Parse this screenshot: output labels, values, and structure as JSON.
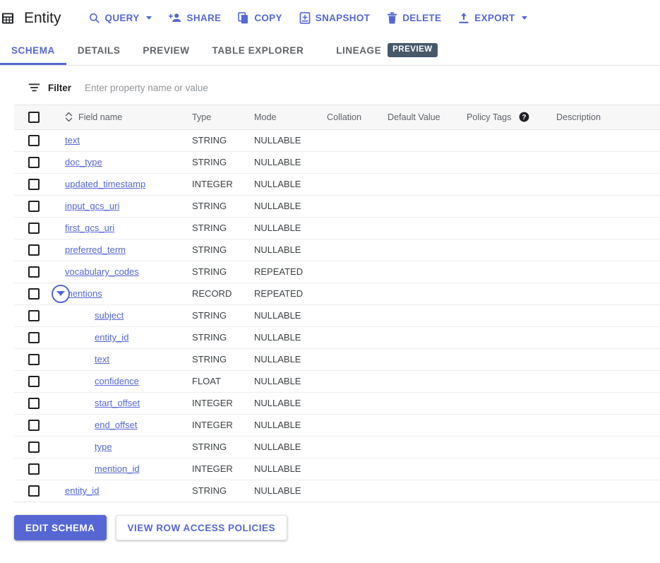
{
  "header": {
    "icon": "table-grid-icon",
    "title": "Entity",
    "actions": [
      {
        "id": "query",
        "label": "QUERY",
        "icon": "search-icon",
        "has_caret": true
      },
      {
        "id": "share",
        "label": "SHARE",
        "icon": "person-add-icon",
        "has_caret": false
      },
      {
        "id": "copy",
        "label": "COPY",
        "icon": "copy-icon",
        "has_caret": false
      },
      {
        "id": "snapshot",
        "label": "SNAPSHOT",
        "icon": "snapshot-icon",
        "has_caret": false
      },
      {
        "id": "delete",
        "label": "DELETE",
        "icon": "trash-icon",
        "has_caret": false
      },
      {
        "id": "export",
        "label": "EXPORT",
        "icon": "upload-icon",
        "has_caret": true
      }
    ]
  },
  "tabs": {
    "items": [
      {
        "id": "schema",
        "label": "SCHEMA",
        "active": true
      },
      {
        "id": "details",
        "label": "DETAILS",
        "active": false
      },
      {
        "id": "preview",
        "label": "PREVIEW",
        "active": false
      },
      {
        "id": "table-explorer",
        "label": "TABLE EXPLORER",
        "active": false
      },
      {
        "id": "lineage",
        "label": "LINEAGE",
        "active": false
      }
    ],
    "lineage_badge": "PREVIEW"
  },
  "filter": {
    "icon": "filter-icon",
    "label": "Filter",
    "placeholder": "Enter property name or value",
    "value": ""
  },
  "table": {
    "columns": [
      {
        "id": "checkbox",
        "label": ""
      },
      {
        "id": "field_name",
        "label": "Field name"
      },
      {
        "id": "type",
        "label": "Type"
      },
      {
        "id": "mode",
        "label": "Mode"
      },
      {
        "id": "collation",
        "label": "Collation"
      },
      {
        "id": "default_value",
        "label": "Default Value"
      },
      {
        "id": "policy_tags",
        "label": "Policy Tags",
        "help_icon": "help-icon"
      },
      {
        "id": "description",
        "label": "Description"
      }
    ],
    "sort_icon": "sort-updown-icon",
    "rows": [
      {
        "name": "text",
        "type": "STRING",
        "mode": "NULLABLE",
        "collation": "",
        "default_value": "",
        "policy_tags": "",
        "description": "",
        "nested": false,
        "expandable": false
      },
      {
        "name": "doc_type",
        "type": "STRING",
        "mode": "NULLABLE",
        "collation": "",
        "default_value": "",
        "policy_tags": "",
        "description": "",
        "nested": false,
        "expandable": false
      },
      {
        "name": "updated_timestamp",
        "type": "INTEGER",
        "mode": "NULLABLE",
        "collation": "",
        "default_value": "",
        "policy_tags": "",
        "description": "",
        "nested": false,
        "expandable": false
      },
      {
        "name": "input_gcs_uri",
        "type": "STRING",
        "mode": "NULLABLE",
        "collation": "",
        "default_value": "",
        "policy_tags": "",
        "description": "",
        "nested": false,
        "expandable": false
      },
      {
        "name": "first_gcs_uri",
        "type": "STRING",
        "mode": "NULLABLE",
        "collation": "",
        "default_value": "",
        "policy_tags": "",
        "description": "",
        "nested": false,
        "expandable": false
      },
      {
        "name": "preferred_term",
        "type": "STRING",
        "mode": "NULLABLE",
        "collation": "",
        "default_value": "",
        "policy_tags": "",
        "description": "",
        "nested": false,
        "expandable": false
      },
      {
        "name": "vocabulary_codes",
        "type": "STRING",
        "mode": "REPEATED",
        "collation": "",
        "default_value": "",
        "policy_tags": "",
        "description": "",
        "nested": false,
        "expandable": false
      },
      {
        "name": "mentions",
        "type": "RECORD",
        "mode": "REPEATED",
        "collation": "",
        "default_value": "",
        "policy_tags": "",
        "description": "",
        "nested": false,
        "expandable": true,
        "expanded": true
      },
      {
        "name": "subject",
        "type": "STRING",
        "mode": "NULLABLE",
        "collation": "",
        "default_value": "",
        "policy_tags": "",
        "description": "",
        "nested": true,
        "expandable": false
      },
      {
        "name": "entity_id",
        "type": "STRING",
        "mode": "NULLABLE",
        "collation": "",
        "default_value": "",
        "policy_tags": "",
        "description": "",
        "nested": true,
        "expandable": false
      },
      {
        "name": "text",
        "type": "STRING",
        "mode": "NULLABLE",
        "collation": "",
        "default_value": "",
        "policy_tags": "",
        "description": "",
        "nested": true,
        "expandable": false
      },
      {
        "name": "confidence",
        "type": "FLOAT",
        "mode": "NULLABLE",
        "collation": "",
        "default_value": "",
        "policy_tags": "",
        "description": "",
        "nested": true,
        "expandable": false
      },
      {
        "name": "start_offset",
        "type": "INTEGER",
        "mode": "NULLABLE",
        "collation": "",
        "default_value": "",
        "policy_tags": "",
        "description": "",
        "nested": true,
        "expandable": false
      },
      {
        "name": "end_offset",
        "type": "INTEGER",
        "mode": "NULLABLE",
        "collation": "",
        "default_value": "",
        "policy_tags": "",
        "description": "",
        "nested": true,
        "expandable": false
      },
      {
        "name": "type",
        "type": "STRING",
        "mode": "NULLABLE",
        "collation": "",
        "default_value": "",
        "policy_tags": "",
        "description": "",
        "nested": true,
        "expandable": false
      },
      {
        "name": "mention_id",
        "type": "INTEGER",
        "mode": "NULLABLE",
        "collation": "",
        "default_value": "",
        "policy_tags": "",
        "description": "",
        "nested": true,
        "expandable": false
      },
      {
        "name": "entity_id",
        "type": "STRING",
        "mode": "NULLABLE",
        "collation": "",
        "default_value": "",
        "policy_tags": "",
        "description": "",
        "nested": false,
        "expandable": false
      }
    ]
  },
  "footer": {
    "edit_schema_label": "EDIT SCHEMA",
    "view_policies_label": "VIEW ROW ACCESS POLICIES"
  },
  "colors": {
    "accent": "#5667d4",
    "badge": "#46586a",
    "text": "#202124",
    "muted": "#5f6368"
  }
}
